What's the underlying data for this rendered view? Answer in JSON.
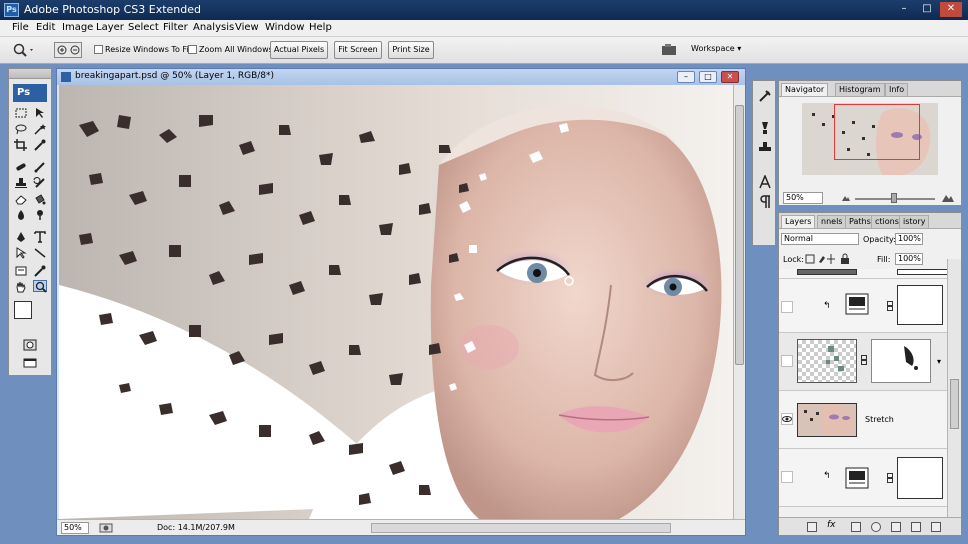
{
  "app": {
    "title": "Adobe Photoshop CS3 Extended",
    "logo": "Ps",
    "window_controls": [
      "minimize-icon",
      "maximize-icon",
      "close-icon"
    ]
  },
  "menu": {
    "items": [
      "File",
      "Edit",
      "Image",
      "Layer",
      "Select",
      "Filter",
      "Analysis",
      "View",
      "Window",
      "Help"
    ]
  },
  "options_bar": {
    "resize_windows_label": "Resize Windows To Fit",
    "zoom_all_label": "Zoom All Windows",
    "actual_pixels_label": "Actual Pixels",
    "fit_screen_label": "Fit Screen",
    "print_size_label": "Print Size",
    "workspace_label": "Workspace ▾"
  },
  "document": {
    "title": "breakingapart.psd @ 50% (Layer 1, RGB/8*)",
    "zoom": "50%",
    "doc_info": "Doc: 14.1M/207.9M"
  },
  "navigator": {
    "tabs": [
      "Navigator",
      "Histogram",
      "Info"
    ],
    "zoom": "50%"
  },
  "layers": {
    "tabs": [
      "Layers",
      "nnels",
      "Paths",
      "ctions",
      "istory"
    ],
    "blend_mode": "Normal",
    "opacity_label": "Opacity:",
    "opacity_value": "100%",
    "lock_label": "Lock:",
    "fill_label": "Fill:",
    "fill_value": "100%",
    "stretch_layer_name": "Stretch"
  },
  "colors": {
    "titlebar": "#0f2a52",
    "desktop": "#6f8fbf",
    "accent": "#2d5fa3",
    "nav_frame": "#e23a3a"
  }
}
